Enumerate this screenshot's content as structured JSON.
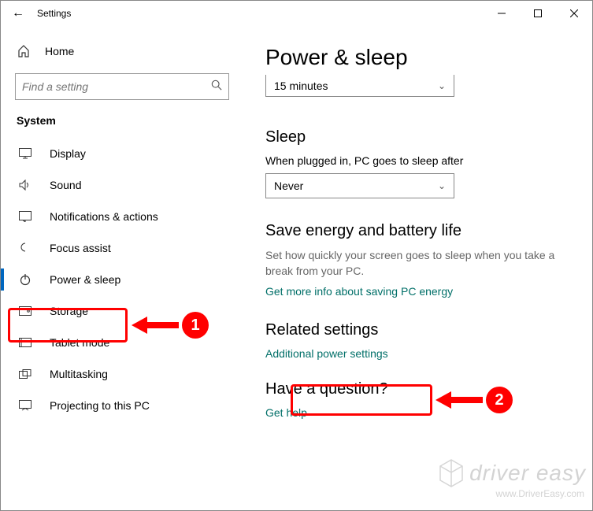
{
  "window": {
    "title": "Settings"
  },
  "sidebar": {
    "home_label": "Home",
    "search_placeholder": "Find a setting",
    "category": "System",
    "items": [
      {
        "label": "Display"
      },
      {
        "label": "Sound"
      },
      {
        "label": "Notifications & actions"
      },
      {
        "label": "Focus assist"
      },
      {
        "label": "Power & sleep"
      },
      {
        "label": "Storage"
      },
      {
        "label": "Tablet mode"
      },
      {
        "label": "Multitasking"
      },
      {
        "label": "Projecting to this PC"
      }
    ]
  },
  "main": {
    "page_title": "Power & sleep",
    "screen_dropdown": "15 minutes",
    "sleep": {
      "heading": "Sleep",
      "label": "When plugged in, PC goes to sleep after",
      "value": "Never"
    },
    "energy": {
      "heading": "Save energy and battery life",
      "desc": "Set how quickly your screen goes to sleep when you take a break from your PC.",
      "link": "Get more info about saving PC energy"
    },
    "related": {
      "heading": "Related settings",
      "link": "Additional power settings"
    },
    "question": {
      "heading": "Have a question?",
      "link": "Get help"
    }
  },
  "annotations": {
    "step1": "1",
    "step2": "2"
  },
  "watermark": {
    "text": "driver easy",
    "url": "www.DriverEasy.com"
  }
}
